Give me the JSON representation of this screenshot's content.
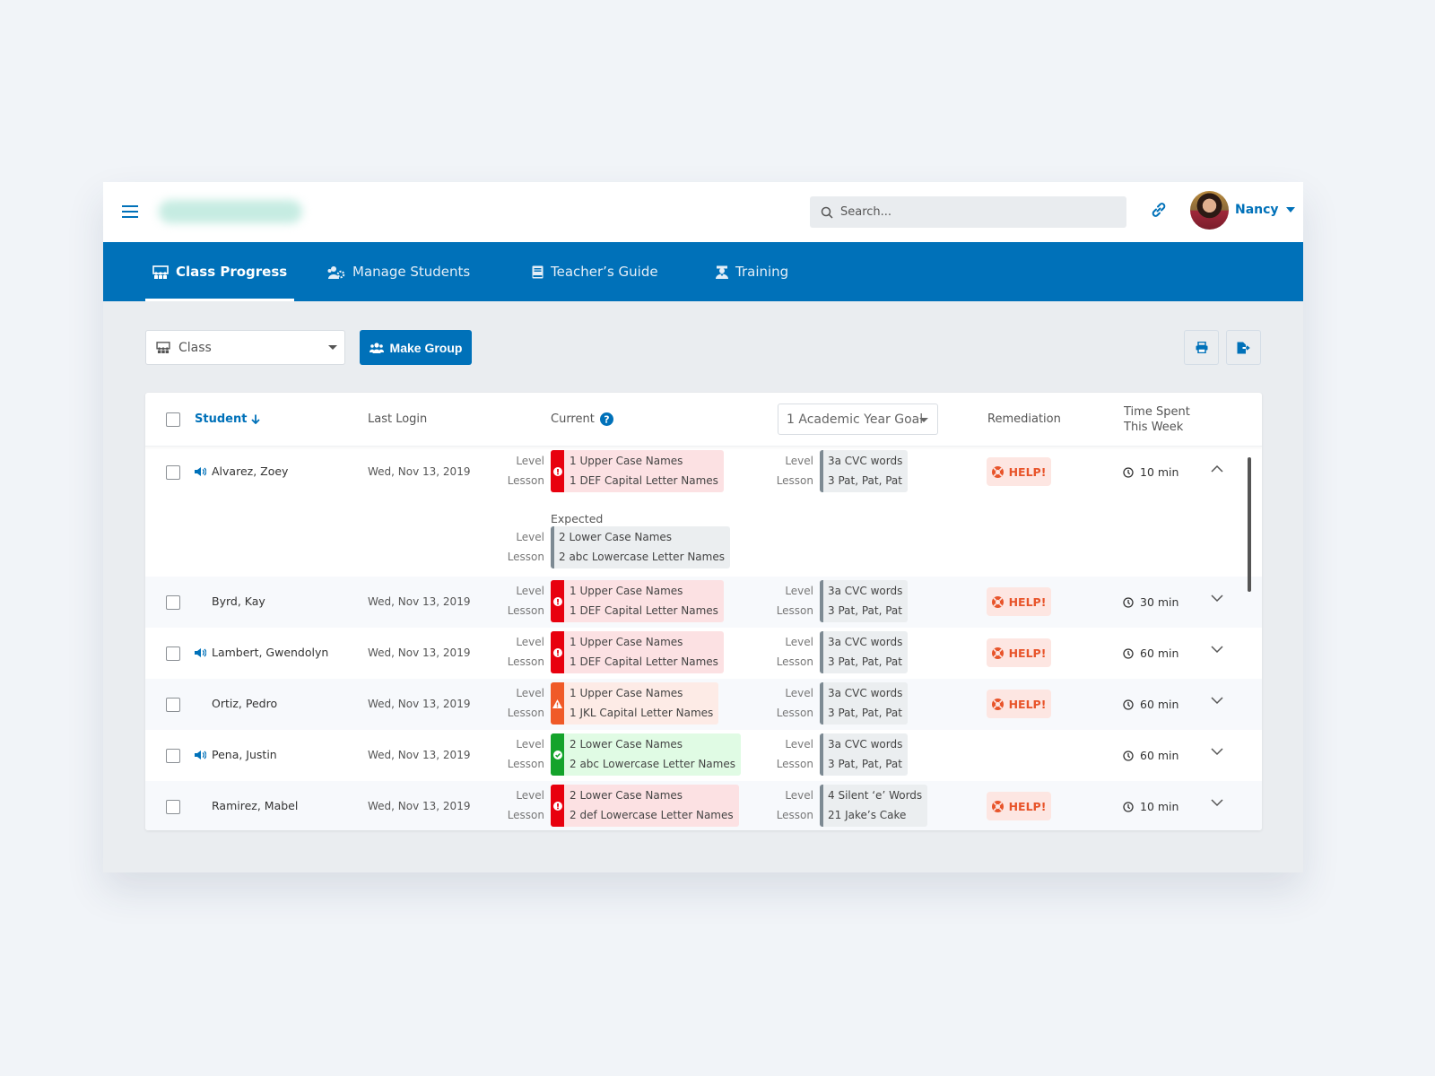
{
  "header": {
    "search_placeholder": "Search...",
    "user_name": "Nancy"
  },
  "nav": {
    "tabs": [
      {
        "label": "Class Progress",
        "icon": "classroom-icon",
        "active": true
      },
      {
        "label": "Manage Students",
        "icon": "users-cog-icon",
        "active": false
      },
      {
        "label": "Teacher’s Guide",
        "icon": "book-icon",
        "active": false
      },
      {
        "label": "Training",
        "icon": "graduate-icon",
        "active": false
      }
    ]
  },
  "toolbar": {
    "class_select_value": "Class",
    "make_group_label": "Make Group",
    "print_icon": "print-icon",
    "export_icon": "file-export-icon"
  },
  "table": {
    "headers": {
      "student": "Student",
      "last_login": "Last Login",
      "current": "Current",
      "goal_select": "1 Academic Year Goal",
      "remediation": "Remediation",
      "time_spent_line1": "Time Spent",
      "time_spent_line2": "This Week"
    },
    "level_label": "Level",
    "lesson_label": "Lesson",
    "expected_label": "Expected",
    "help_label": "HELP!",
    "rows": [
      {
        "name": "Alvarez, Zoey",
        "audio": true,
        "last_login": "Wed, Nov 13, 2019",
        "current_status": "behind",
        "current_level": "1 Upper Case Names",
        "current_lesson": "1 DEF Capital Letter Names",
        "goal_level": "3a CVC words",
        "goal_lesson": "3 Pat, Pat, Pat",
        "remediation": true,
        "time": "10 min",
        "expanded": true,
        "expected_level": "2 Lower Case Names",
        "expected_lesson": "2 abc Lowercase Letter Names"
      },
      {
        "name": "Byrd, Kay",
        "audio": false,
        "last_login": "Wed, Nov 13, 2019",
        "current_status": "behind",
        "current_level": "1 Upper Case Names",
        "current_lesson": "1 DEF Capital Letter Names",
        "goal_level": "3a CVC words",
        "goal_lesson": "3 Pat, Pat, Pat",
        "remediation": true,
        "time": "30 min",
        "expanded": false
      },
      {
        "name": "Lambert, Gwendolyn",
        "audio": true,
        "last_login": "Wed, Nov 13, 2019",
        "current_status": "behind",
        "current_level": "1 Upper Case Names",
        "current_lesson": "1 DEF Capital Letter Names",
        "goal_level": "3a CVC words",
        "goal_lesson": "3 Pat, Pat, Pat",
        "remediation": true,
        "time": "60 min",
        "expanded": false
      },
      {
        "name": "Ortiz, Pedro",
        "audio": false,
        "last_login": "Wed, Nov 13, 2019",
        "current_status": "warning",
        "current_level": "1 Upper Case Names",
        "current_lesson": "1 JKL Capital Letter Names",
        "goal_level": "3a CVC words",
        "goal_lesson": "3 Pat, Pat, Pat",
        "remediation": true,
        "time": "60 min",
        "expanded": false
      },
      {
        "name": "Pena, Justin",
        "audio": true,
        "last_login": "Wed, Nov 13, 2019",
        "current_status": "on-track",
        "current_level": "2 Lower Case Names",
        "current_lesson": "2 abc Lowercase Letter Names",
        "goal_level": "3a CVC words",
        "goal_lesson": "3 Pat, Pat, Pat",
        "remediation": false,
        "time": "60 min",
        "expanded": false
      },
      {
        "name": "Ramirez, Mabel",
        "audio": false,
        "last_login": "Wed, Nov 13, 2019",
        "current_status": "behind",
        "current_level": "2 Lower Case Names",
        "current_lesson": "2 def Lowercase Letter Names",
        "goal_level": "4 Silent ‘e’ Words",
        "goal_lesson": "21 Jake’s Cake",
        "remediation": true,
        "time": "10 min",
        "expanded": false
      }
    ]
  },
  "colors": {
    "brand": "#0071b9",
    "behind": "#e8000e",
    "warning": "#f05a28",
    "on_track": "#14a32b",
    "help": "#e8542a"
  }
}
